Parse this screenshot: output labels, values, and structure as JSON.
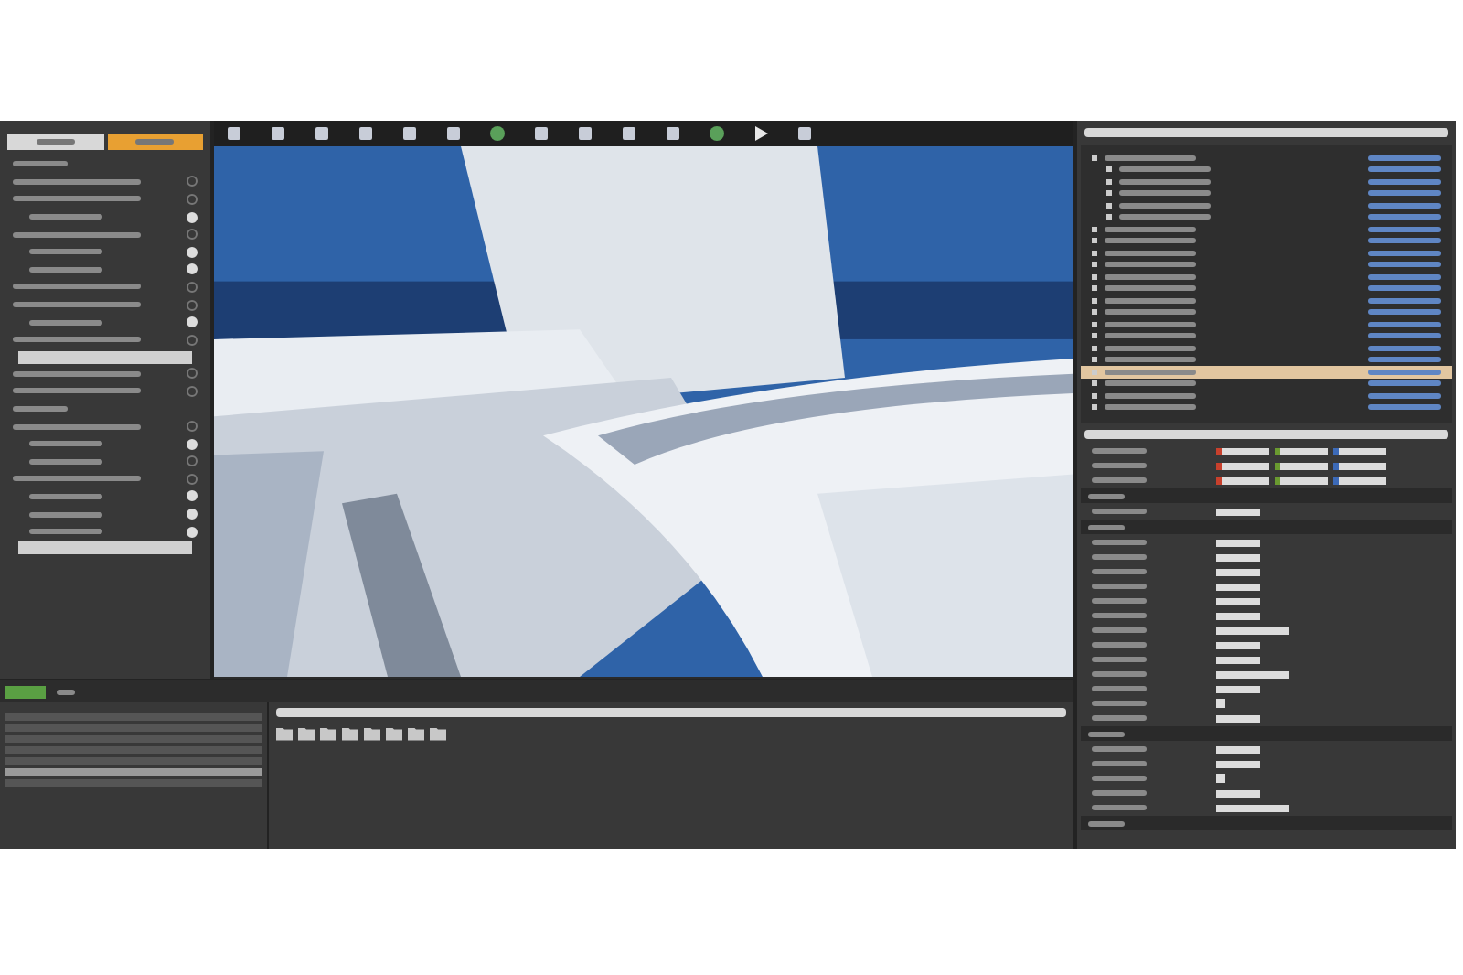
{
  "left_panel": {
    "tabs": [
      {
        "selected": false
      },
      {
        "selected": true
      }
    ],
    "rows": [
      {
        "kind": "header"
      },
      {
        "kind": "toggle",
        "checked": false
      },
      {
        "kind": "toggle",
        "checked": false
      },
      {
        "kind": "sub",
        "checked": true
      },
      {
        "kind": "toggle",
        "checked": false
      },
      {
        "kind": "sub",
        "checked": true
      },
      {
        "kind": "sub",
        "checked": true
      },
      {
        "kind": "toggle",
        "checked": false
      },
      {
        "kind": "toggle",
        "checked": false
      },
      {
        "kind": "sub",
        "checked": true
      },
      {
        "kind": "toggle",
        "checked": false
      },
      {
        "kind": "button"
      },
      {
        "kind": "toggle",
        "checked": false
      },
      {
        "kind": "toggle",
        "checked": false
      },
      {
        "kind": "header"
      },
      {
        "kind": "toggle",
        "checked": false
      },
      {
        "kind": "sub",
        "checked": true
      },
      {
        "kind": "sub",
        "checked": false
      },
      {
        "kind": "toggle",
        "checked": false
      },
      {
        "kind": "sub",
        "checked": true
      },
      {
        "kind": "sub",
        "checked": true
      },
      {
        "kind": "sub",
        "checked": true
      },
      {
        "kind": "button"
      }
    ]
  },
  "toolbar": {
    "tools": [
      {
        "kind": "box"
      },
      {
        "kind": "box"
      },
      {
        "kind": "box"
      },
      {
        "kind": "box"
      },
      {
        "kind": "box"
      },
      {
        "kind": "box"
      },
      {
        "kind": "globe"
      },
      {
        "kind": "box"
      },
      {
        "kind": "box"
      },
      {
        "kind": "box"
      },
      {
        "kind": "box"
      },
      {
        "kind": "globe"
      },
      {
        "kind": "play"
      },
      {
        "kind": "box"
      }
    ]
  },
  "outliner": {
    "items": [
      {
        "selected": false,
        "children": [
          {
            "selected": false
          },
          {
            "selected": false
          },
          {
            "selected": false
          },
          {
            "selected": false
          },
          {
            "selected": false
          }
        ]
      },
      {
        "selected": false
      },
      {
        "selected": false
      },
      {
        "selected": false
      },
      {
        "selected": false
      },
      {
        "selected": false
      },
      {
        "selected": false
      },
      {
        "selected": false
      },
      {
        "selected": false
      },
      {
        "selected": false
      },
      {
        "selected": false
      },
      {
        "selected": false
      },
      {
        "selected": false
      },
      {
        "selected": true
      },
      {
        "selected": false
      },
      {
        "selected": false
      },
      {
        "selected": false
      }
    ]
  },
  "details": {
    "rows": [
      {
        "kind": "vector"
      },
      {
        "kind": "vector"
      },
      {
        "kind": "vector"
      },
      {
        "kind": "section"
      },
      {
        "kind": "field"
      },
      {
        "kind": "section"
      },
      {
        "kind": "field"
      },
      {
        "kind": "field"
      },
      {
        "kind": "field"
      },
      {
        "kind": "field"
      },
      {
        "kind": "field"
      },
      {
        "kind": "field"
      },
      {
        "kind": "wide"
      },
      {
        "kind": "field"
      },
      {
        "kind": "field"
      },
      {
        "kind": "wide"
      },
      {
        "kind": "field"
      },
      {
        "kind": "check",
        "checked": true
      },
      {
        "kind": "field"
      },
      {
        "kind": "section"
      },
      {
        "kind": "field"
      },
      {
        "kind": "field"
      },
      {
        "kind": "check",
        "checked": true
      },
      {
        "kind": "field"
      },
      {
        "kind": "wide"
      },
      {
        "kind": "section"
      }
    ]
  },
  "content_browser": {
    "tree": [
      {
        "selected": false
      },
      {
        "selected": false
      },
      {
        "selected": false
      },
      {
        "selected": false
      },
      {
        "selected": false
      },
      {
        "selected": true
      },
      {
        "selected": false
      }
    ],
    "folders": [
      {
        "kind": "folder"
      },
      {
        "kind": "folder"
      },
      {
        "kind": "folder"
      },
      {
        "kind": "folder"
      },
      {
        "kind": "folder"
      },
      {
        "kind": "folder"
      },
      {
        "kind": "folder"
      },
      {
        "kind": "folder"
      }
    ]
  }
}
